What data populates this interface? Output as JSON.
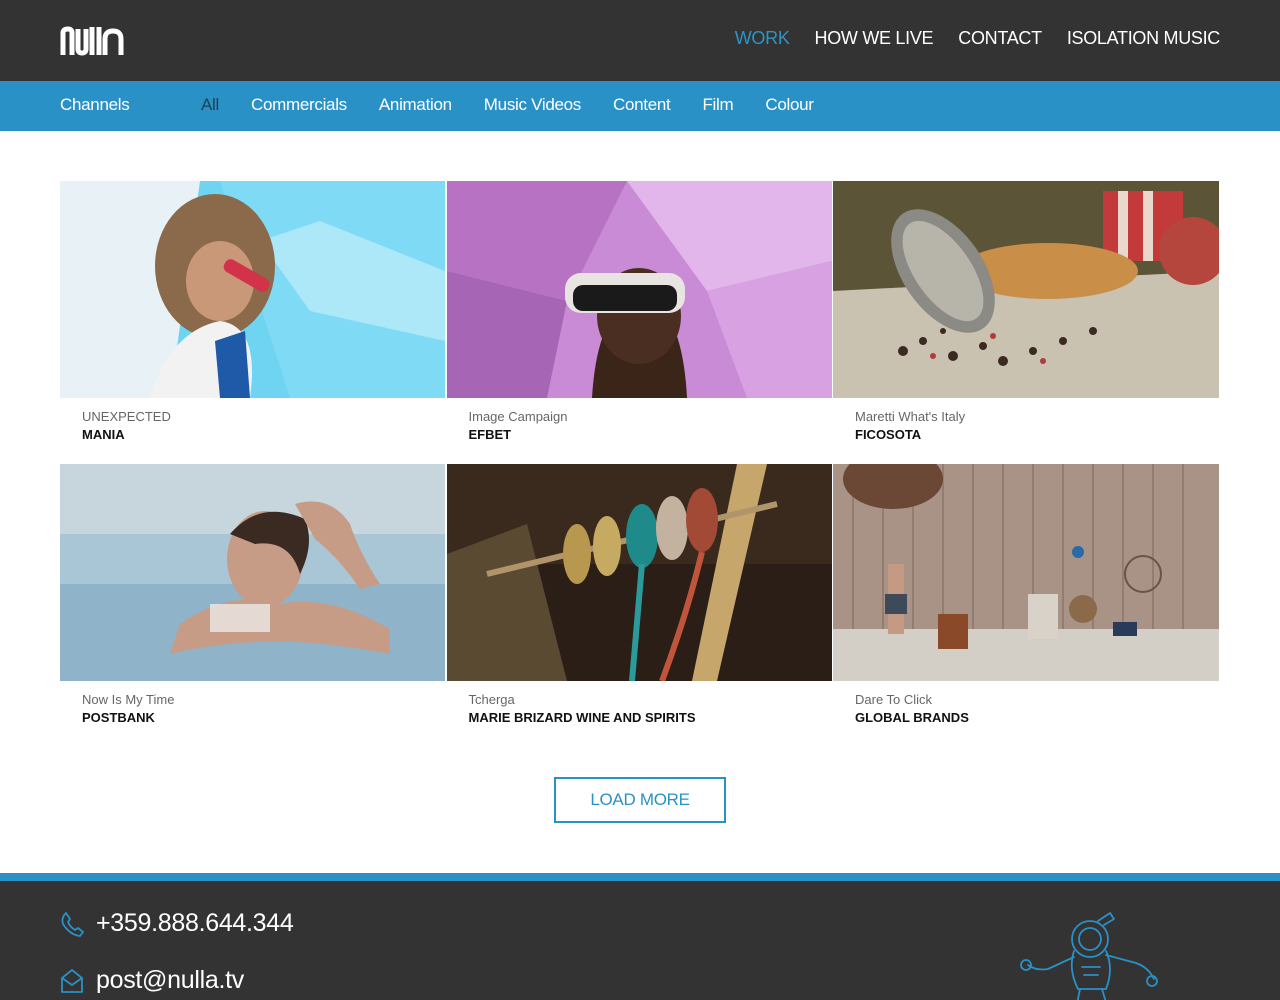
{
  "header": {
    "logo_text": "nulla",
    "nav": [
      {
        "label": "WORK",
        "active": true
      },
      {
        "label": "HOW WE LIVE",
        "active": false
      },
      {
        "label": "CONTACT",
        "active": false
      },
      {
        "label": "ISOLATION MUSIC",
        "active": false
      }
    ]
  },
  "channels": {
    "label": "Channels",
    "filters": [
      {
        "label": "All",
        "active": true
      },
      {
        "label": "Commercials",
        "active": false
      },
      {
        "label": "Animation",
        "active": false
      },
      {
        "label": "Music Videos",
        "active": false
      },
      {
        "label": "Content",
        "active": false
      },
      {
        "label": "Film",
        "active": false
      },
      {
        "label": "Colour",
        "active": false
      }
    ]
  },
  "projects": [
    {
      "subtitle": "UNEXPECTED",
      "title": "MANIA"
    },
    {
      "subtitle": "Image Campaign",
      "title": "EFBET"
    },
    {
      "subtitle": "Maretti What's Italy",
      "title": "FICOSOTA"
    },
    {
      "subtitle": "Now Is My Time",
      "title": "POSTBANK"
    },
    {
      "subtitle": "Tcherga",
      "title": "MARIE BRIZARD WINE AND SPIRITS"
    },
    {
      "subtitle": "Dare To Click",
      "title": "GLOBAL BRANDS"
    }
  ],
  "load_more_label": "LOAD MORE",
  "footer": {
    "phone": "+359.888.644.344",
    "email": "post@nulla.tv"
  },
  "colors": {
    "accent": "#2a91c6",
    "dark": "#333333"
  },
  "icons": [
    "phone-icon",
    "mail-icon",
    "astronaut-icon"
  ]
}
